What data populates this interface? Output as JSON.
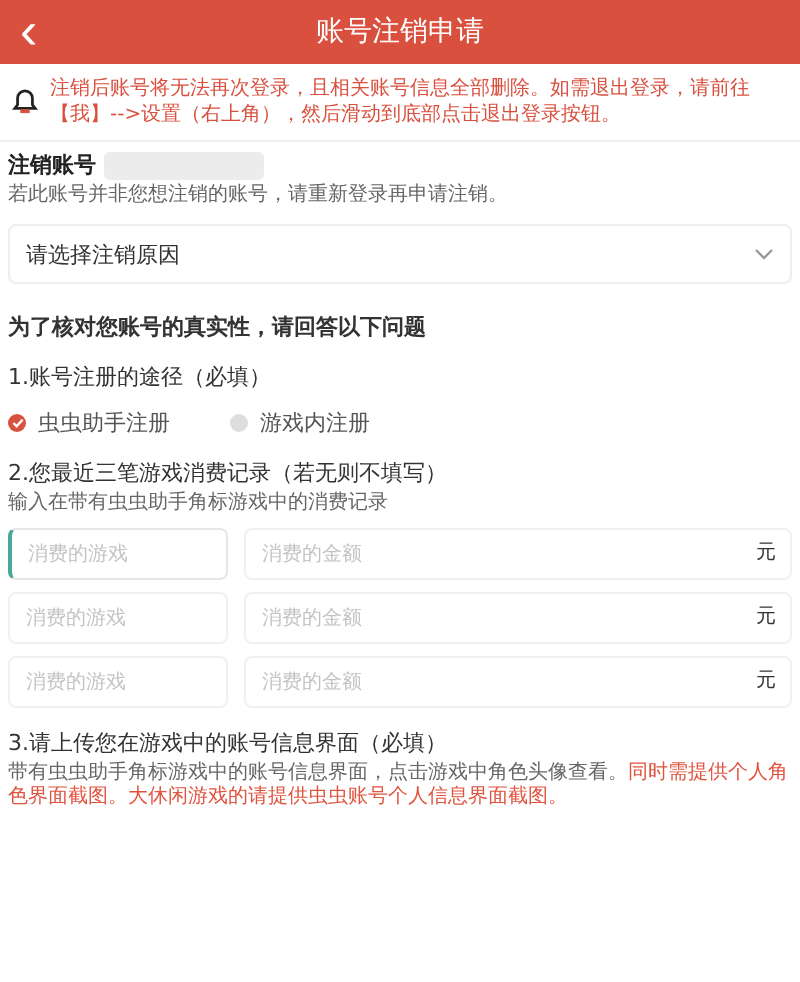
{
  "header": {
    "title": "账号注销申请",
    "back": "‹"
  },
  "notice": "注销后账号将无法再次登录，且相关账号信息全部删除。如需退出登录，请前往【我】-->设置（右上角），然后滑动到底部点击退出登录按钮。",
  "account": {
    "label": "注销账号",
    "hint": "若此账号并非您想注销的账号，请重新登录再申请注销。"
  },
  "reason_select": {
    "placeholder": "请选择注销原因"
  },
  "questions_title": "为了核对您账号的真实性，请回答以下问题",
  "q1": {
    "title": "1.账号注册的途径（必填）",
    "options": [
      {
        "label": "虫虫助手注册",
        "selected": true
      },
      {
        "label": "游戏内注册",
        "selected": false
      }
    ]
  },
  "q2": {
    "title": "2.您最近三笔游戏消费记录（若无则不填写）",
    "hint": "输入在带有虫虫助手角标游戏中的消费记录",
    "rows": [
      {
        "game_placeholder": "消费的游戏",
        "amount_placeholder": "消费的金额",
        "unit": "元",
        "focused": true
      },
      {
        "game_placeholder": "消费的游戏",
        "amount_placeholder": "消费的金额",
        "unit": "元",
        "focused": false
      },
      {
        "game_placeholder": "消费的游戏",
        "amount_placeholder": "消费的金额",
        "unit": "元",
        "focused": false
      }
    ]
  },
  "q3": {
    "title": "3.请上传您在游戏中的账号信息界面（必填）",
    "hint": "带有虫虫助手角标游戏中的账号信息界面，点击游戏中角色头像查看。",
    "hint_highlight": "同时需提供个人角色界面截图。大休闲游戏的请提供虫虫账号个人信息界面截图。"
  }
}
